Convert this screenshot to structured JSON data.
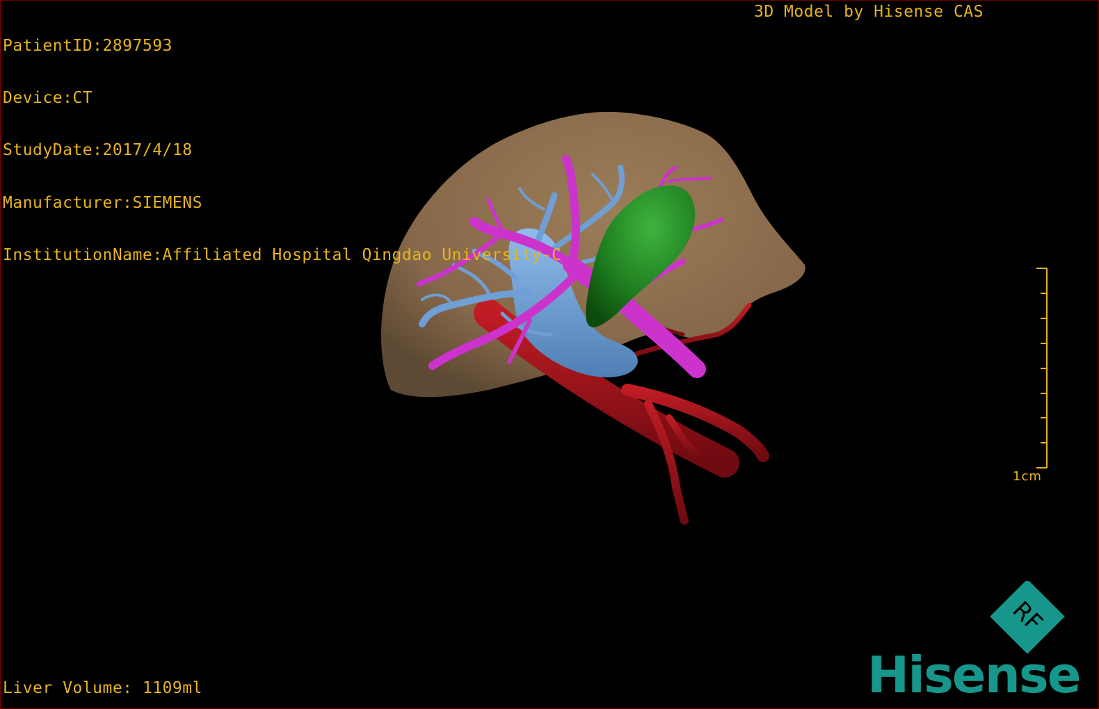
{
  "header": {
    "patient_id": "PatientID:2897593",
    "device": "Device:CT",
    "study_date": "StudyDate:2017/4/18",
    "manufacturer": "Manufacturer:SIEMENS",
    "institution": "InstitutionName:Affiliated Hospital Qingdao University-C"
  },
  "model_credit": "3D Model by Hisense CAS",
  "footer": {
    "liver_volume": "Liver Volume: 1109ml"
  },
  "scale": {
    "label": "1cm"
  },
  "logo": {
    "badge_text": "RF",
    "brand": "Hisense"
  },
  "colors": {
    "overlay_text": "#e8b41e",
    "liver": "#8a6d4b",
    "gallbladder": "#1e7d1e",
    "portal_vein": "#cc33cc",
    "hepatic_vein": "#6f9fd6",
    "artery": "#a8141c",
    "brand": "#17968b"
  }
}
